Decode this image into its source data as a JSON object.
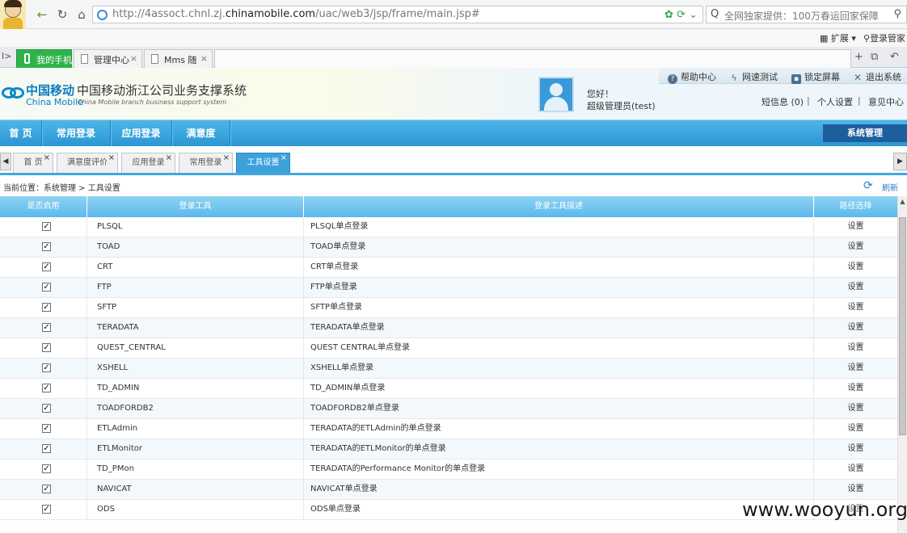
{
  "browser": {
    "url_prefix": "http://4assoct.chnl.zj.",
    "url_host": "chinamobile.com",
    "url_path": "/uac/web3/jsp/frame/main.jsp#",
    "search_placeholder": "全网独家提供：100万春运回家保障",
    "ext_label": "扩展",
    "login_label": "登录管家",
    "tabs": [
      {
        "label": "我的手机",
        "active": true
      },
      {
        "label": "管理中心"
      },
      {
        "label": "Mms 随"
      }
    ]
  },
  "header": {
    "logo_cn": "中国移动",
    "logo_en": "China Mobile",
    "system_title": "中国移动浙江公司业务支撑系统",
    "system_subtitle": "China Mobile branch business support system",
    "greeting": "您好！",
    "user_name": "超级管理员(test)",
    "tools": [
      {
        "label": "帮助中心",
        "icon": "help-icon"
      },
      {
        "label": "网速测试",
        "icon": "lightning-icon"
      },
      {
        "label": "锁定屏幕",
        "icon": "lock-icon"
      },
      {
        "label": "退出系统",
        "icon": "close-icon"
      }
    ],
    "messages_label": "短信息 (0)",
    "personal_settings": "个人设置",
    "feedback": "意见中心"
  },
  "nav": {
    "items": [
      "首 页",
      "常用登录",
      "应用登录",
      "满意度"
    ],
    "system_manage": "系统管理"
  },
  "page_tabs": [
    {
      "label": "首 页"
    },
    {
      "label": "满意度评价"
    },
    {
      "label": "应用登录"
    },
    {
      "label": "常用登录"
    },
    {
      "label": "工具设置",
      "active": true
    }
  ],
  "breadcrumb": "当前位置：系统管理 > 工具设置",
  "refresh_label": "刷新",
  "table": {
    "columns": [
      "是否启用",
      "登录工具",
      "登录工具描述",
      "路径选择"
    ],
    "action_label": "设置",
    "rows": [
      {
        "enabled": true,
        "tool": "PLSQL",
        "desc": "PLSQL单点登录"
      },
      {
        "enabled": true,
        "tool": "TOAD",
        "desc": "TOAD单点登录"
      },
      {
        "enabled": true,
        "tool": "CRT",
        "desc": "CRT单点登录"
      },
      {
        "enabled": true,
        "tool": "FTP",
        "desc": "FTP单点登录"
      },
      {
        "enabled": true,
        "tool": "SFTP",
        "desc": "SFTP单点登录"
      },
      {
        "enabled": true,
        "tool": "TERADATA",
        "desc": "TERADATA单点登录"
      },
      {
        "enabled": true,
        "tool": "QUEST_CENTRAL",
        "desc": "QUEST CENTRAL单点登录"
      },
      {
        "enabled": true,
        "tool": "XSHELL",
        "desc": "XSHELL单点登录"
      },
      {
        "enabled": true,
        "tool": "TD_ADMIN",
        "desc": "TD_ADMIN单点登录"
      },
      {
        "enabled": true,
        "tool": "TOADFORDB2",
        "desc": "TOADFORDB2单点登录"
      },
      {
        "enabled": true,
        "tool": "ETLAdmin",
        "desc": "TERADATA的ETLAdmin的单点登录"
      },
      {
        "enabled": true,
        "tool": "ETLMonitor",
        "desc": "TERADATA的ETLMonitor的单点登录"
      },
      {
        "enabled": true,
        "tool": "TD_PMon",
        "desc": "TERADATA的Performance Monitor的单点登录"
      },
      {
        "enabled": true,
        "tool": "NAVICAT",
        "desc": "NAVICAT单点登录"
      },
      {
        "enabled": true,
        "tool": "ODS",
        "desc": "ODS单点登录"
      }
    ]
  },
  "watermark": "www.wooyun.org"
}
